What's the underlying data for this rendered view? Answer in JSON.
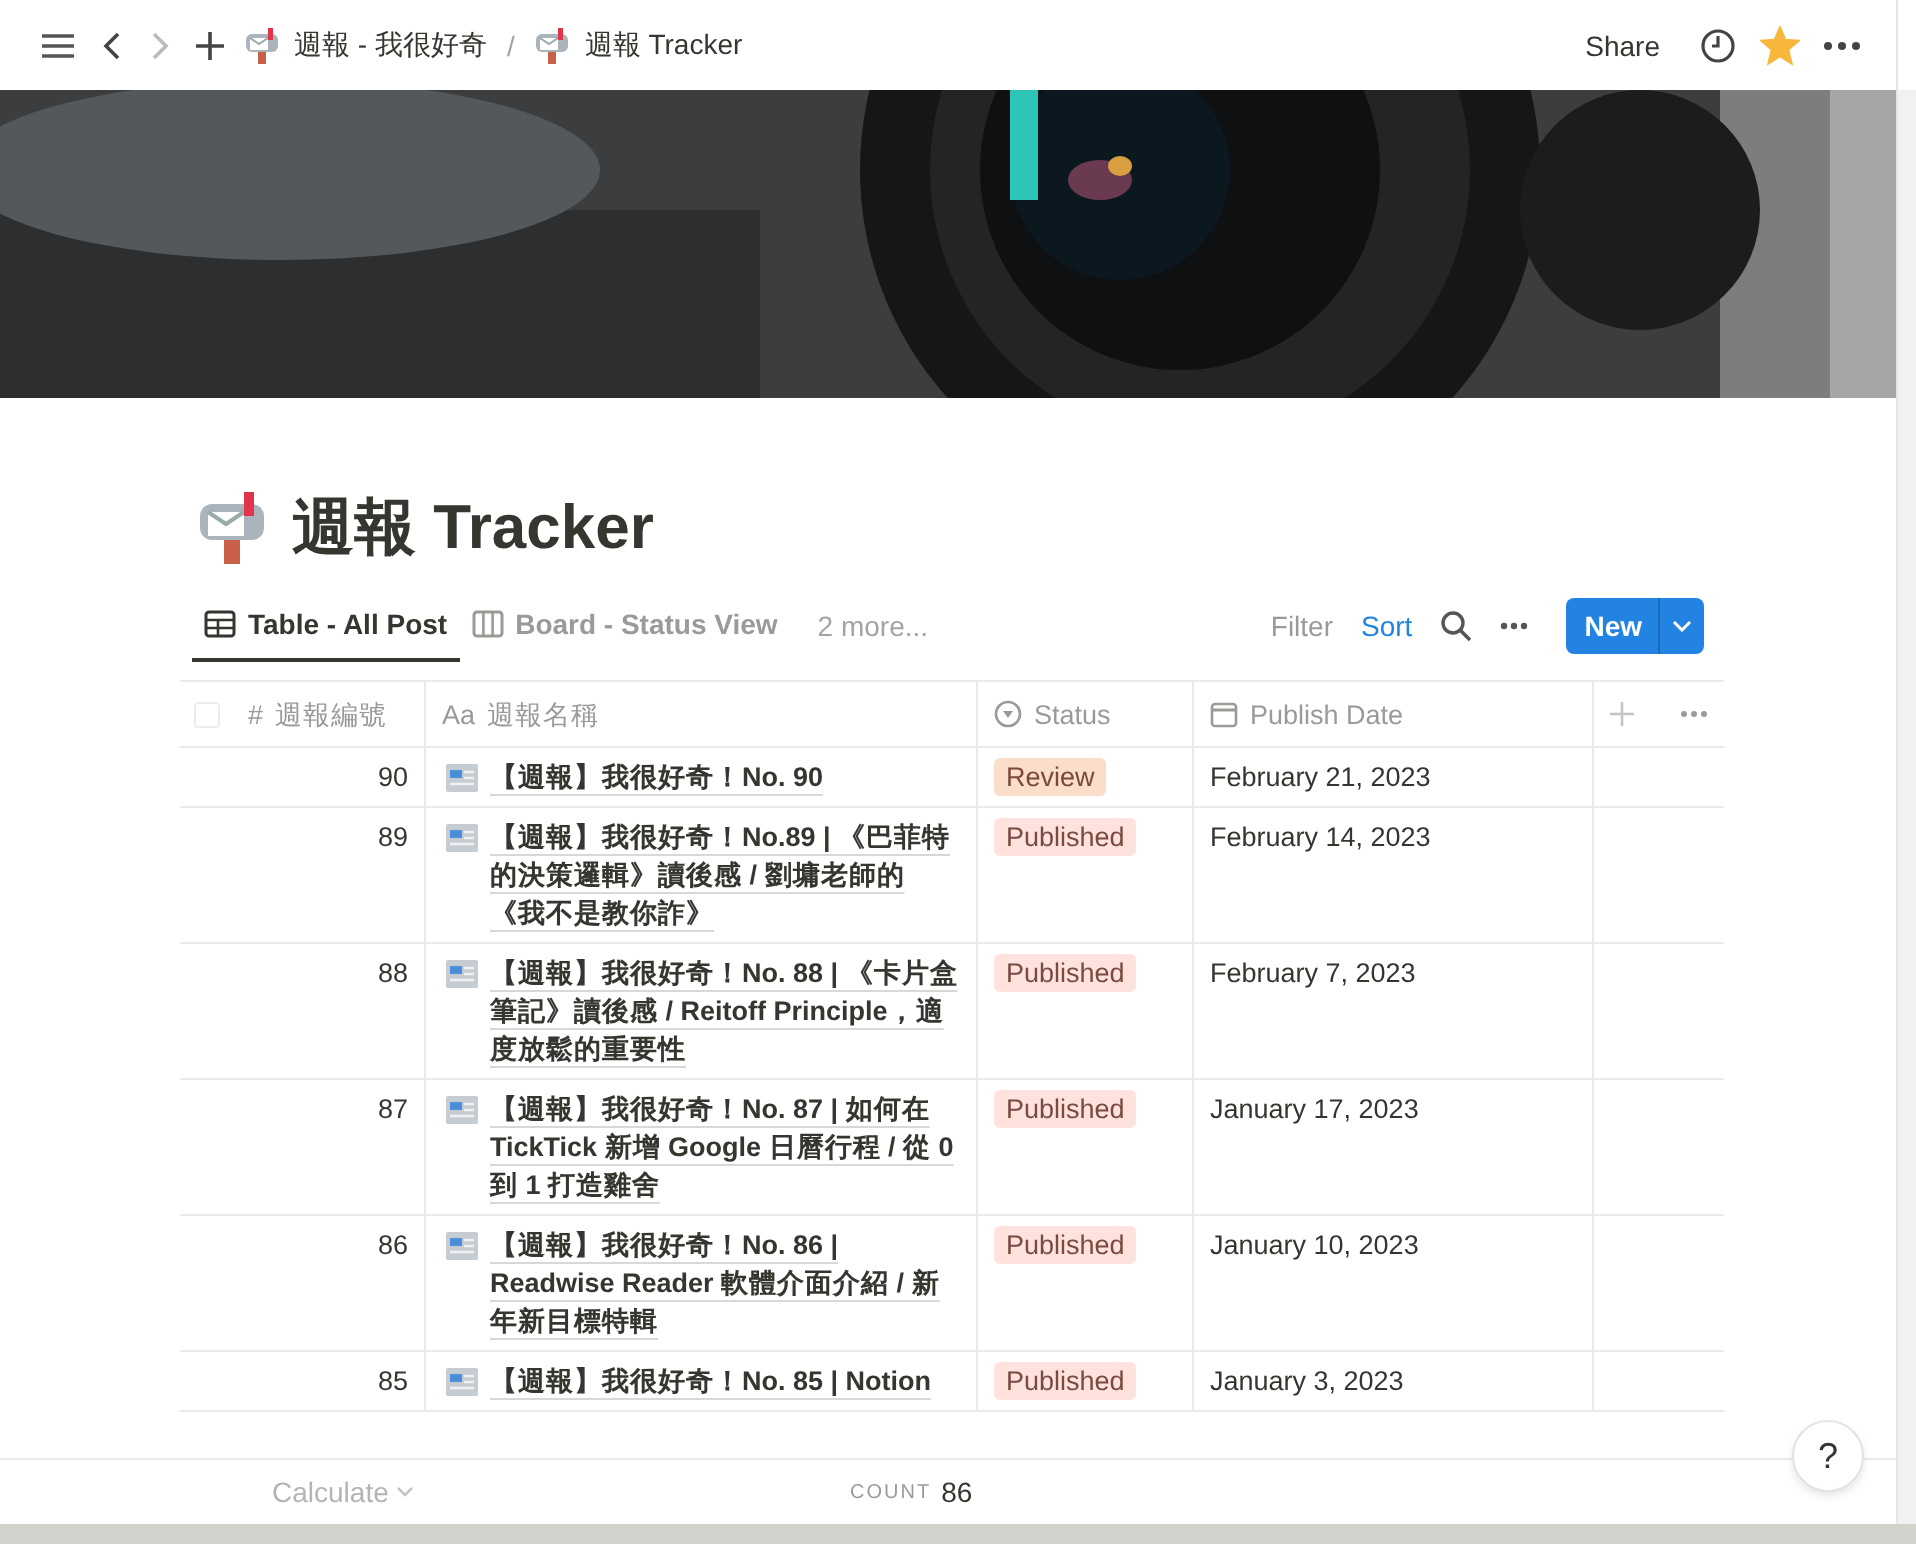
{
  "topbar": {
    "back_disabled": false,
    "forward_disabled": true,
    "breadcrumbs": [
      {
        "text": "週報 - 我很好奇"
      },
      {
        "text": "週報 Tracker"
      }
    ],
    "separator": "/",
    "share": "Share",
    "favorite": true
  },
  "title": "週報 Tracker",
  "views": [
    {
      "kind": "table",
      "label": "Table - All Post",
      "selected": true
    },
    {
      "kind": "board",
      "label": "Board - Status View",
      "selected": false
    }
  ],
  "more_views": "2 more...",
  "toolbar": {
    "filter": {
      "label": "Filter",
      "active": false
    },
    "sort": {
      "label": "Sort",
      "active": true
    },
    "new_button": "New"
  },
  "select_all_checked": false,
  "columns": [
    {
      "kind": "number",
      "prefix": "#",
      "label": "週報編號"
    },
    {
      "kind": "title",
      "prefix": "Aa",
      "label": "週報名稱"
    },
    {
      "kind": "status",
      "label": "Status"
    },
    {
      "kind": "date",
      "label": "Publish Date"
    }
  ],
  "rows": [
    {
      "number": "90",
      "title": "【週報】我很好奇！No. 90",
      "status": {
        "label": "Review",
        "color": "#fadec9"
      },
      "date": "February 21, 2023"
    },
    {
      "number": "89",
      "title": "【週報】我很好奇！No.89 | 《巴菲特的決策邏輯》讀後感 / 劉墉老師的《我不是教你詐》",
      "status": {
        "label": "Published",
        "color": "#ffe2dd"
      },
      "date": "February 14, 2023"
    },
    {
      "number": "88",
      "title": "【週報】我很好奇！No. 88 | 《卡片盒筆記》讀後感 / Reitoff Principle，適度放鬆的重要性",
      "status": {
        "label": "Published",
        "color": "#ffe2dd"
      },
      "date": "February 7, 2023"
    },
    {
      "number": "87",
      "title": "【週報】我很好奇！No. 87 | 如何在 TickTick 新增 Google 日曆行程 / 從 0 到 1 打造雞舍",
      "status": {
        "label": "Published",
        "color": "#ffe2dd"
      },
      "date": "January 17, 2023"
    },
    {
      "number": "86",
      "title": "【週報】我很好奇！No. 86 | Readwise Reader 軟體介面介紹 / 新年新目標特輯",
      "status": {
        "label": "Published",
        "color": "#ffe2dd"
      },
      "date": "January 10, 2023"
    },
    {
      "number": "85",
      "title": "【週報】我很好奇！No. 85 | Notion",
      "status": {
        "label": "Published",
        "color": "#ffe2dd"
      },
      "date": "January 3, 2023"
    }
  ],
  "footer": {
    "calculate": "Calculate",
    "count_label": "COUNT",
    "count": "86"
  },
  "help": "?"
}
